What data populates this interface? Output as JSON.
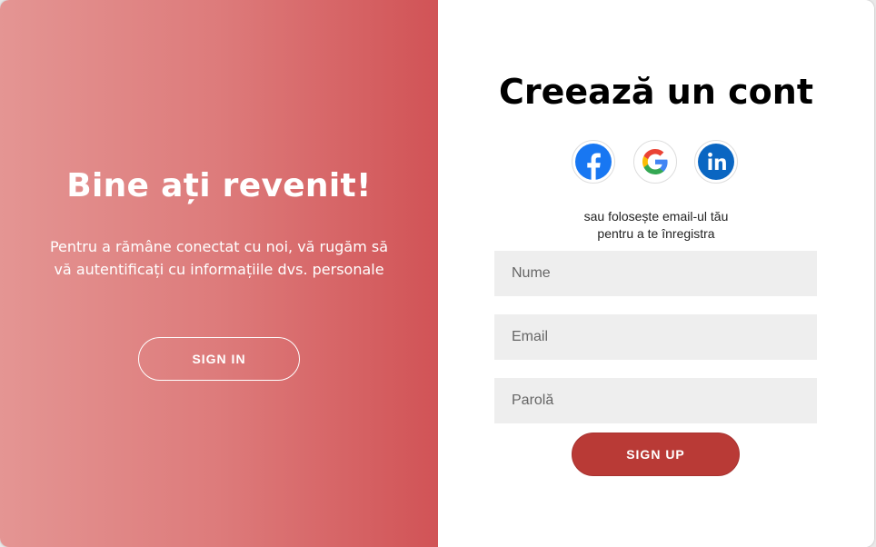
{
  "colors": {
    "gradient_start": "#e49593",
    "gradient_end": "#d15356",
    "primary_button": "#b93a36",
    "input_background": "#eeeeee",
    "facebook": "#1877f2",
    "linkedin": "#0a66c2"
  },
  "welcome_panel": {
    "title": "Bine ați revenit!",
    "text": "Pentru a rămâne conectat cu noi, vă rugăm să vă autentificați cu informațiile dvs. personale",
    "sign_in_label": "SIGN IN"
  },
  "signup_panel": {
    "title": "Creează un cont",
    "social_icons": [
      "facebook-icon",
      "google-icon",
      "linkedin-icon"
    ],
    "divider_line1": "sau folosește email-ul tău",
    "divider_line2": "pentru a te înregistra",
    "fields": {
      "name_placeholder": "Nume",
      "email_placeholder": "Email",
      "password_placeholder": "Parolă"
    },
    "sign_up_label": "SIGN UP"
  }
}
